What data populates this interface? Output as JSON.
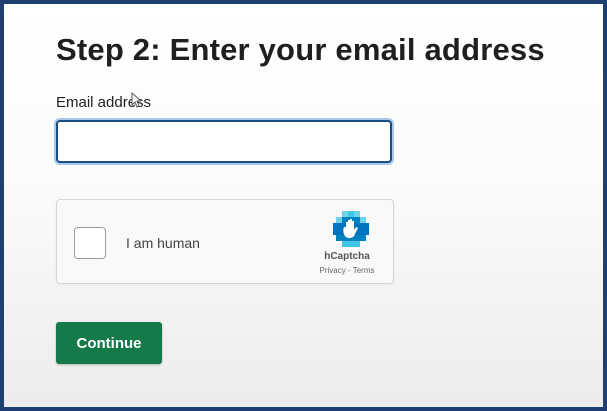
{
  "heading": "Step 2: Enter your email address",
  "email": {
    "label": "Email address",
    "value": "",
    "placeholder": ""
  },
  "captcha": {
    "label": "I am human",
    "brand": "hCaptcha",
    "privacy_link": "Privacy",
    "separator": " - ",
    "terms_link": "Terms",
    "logo_icon": "hcaptcha-hand-icon",
    "logo_colors": [
      "#0074bf",
      "#0082bf",
      "#00b4e1"
    ]
  },
  "continue_button": {
    "label": "Continue",
    "color": "#16794a"
  },
  "colors": {
    "frame_border": "#1f3f73",
    "input_focus_border": "#1a4f86"
  }
}
